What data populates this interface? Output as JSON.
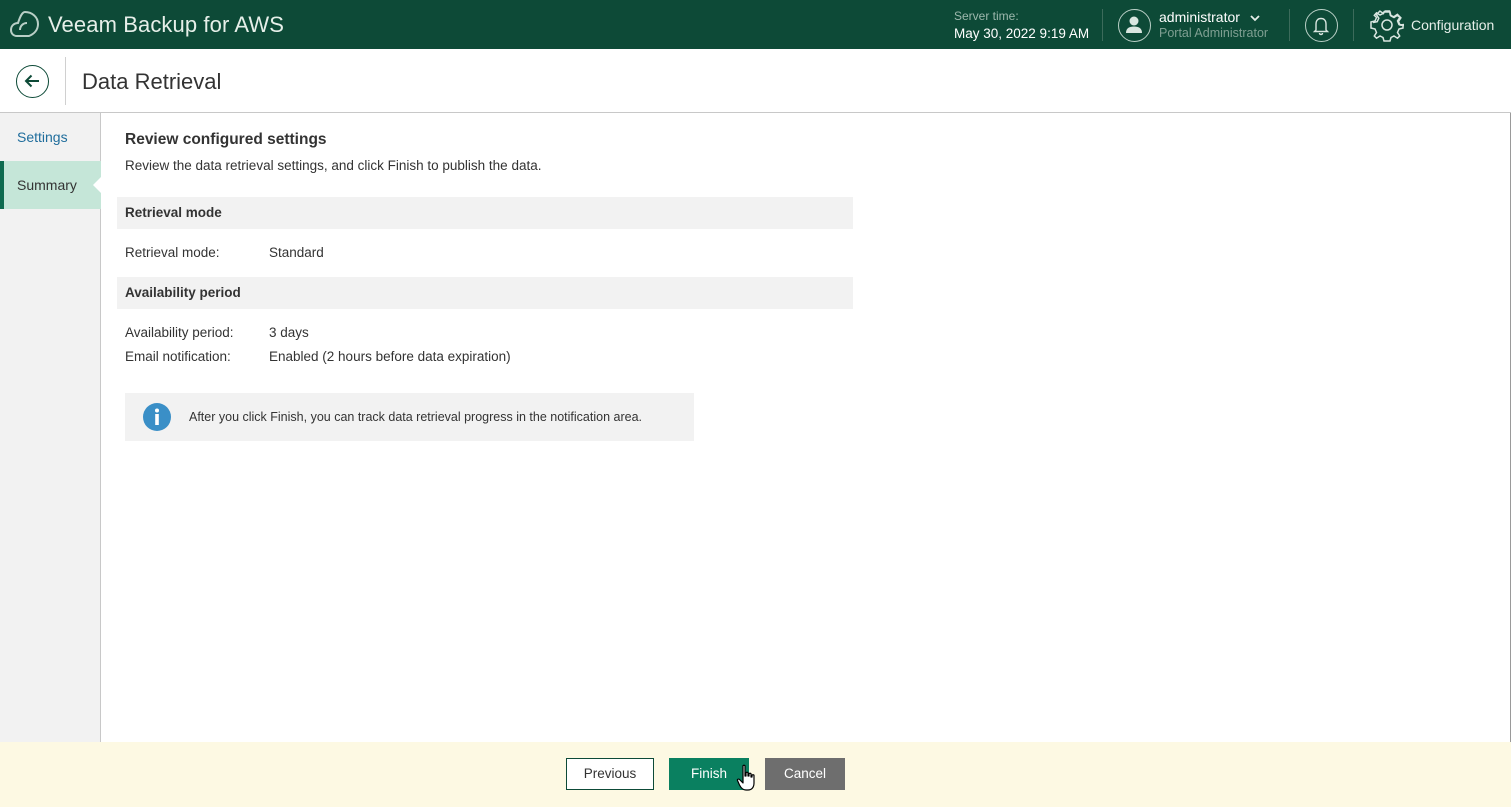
{
  "app": {
    "title": "Veeam Backup for AWS"
  },
  "topbar": {
    "server_time_label": "Server time:",
    "server_time_value": "May 30, 2022 9:19 AM",
    "user_name": "administrator",
    "user_role": "Portal Administrator",
    "config_label": "Configuration",
    "icons": [
      "veeam-logo",
      "user-avatar-icon",
      "chevron-down-icon",
      "bell-icon",
      "gear-icon"
    ]
  },
  "header": {
    "title": "Data Retrieval"
  },
  "wizard": {
    "steps": [
      {
        "label": "Settings",
        "state": "link"
      },
      {
        "label": "Summary",
        "state": "active"
      }
    ]
  },
  "summary": {
    "title": "Review configured settings",
    "description": "Review the data retrieval settings, and click Finish to publish the data.",
    "groups": [
      {
        "header": "Retrieval mode",
        "rows": [
          {
            "key": "Retrieval mode:",
            "value": "Standard"
          }
        ]
      },
      {
        "header": "Availability period",
        "rows": [
          {
            "key": "Availability period:",
            "value": "3 days"
          },
          {
            "key": "Email notification:",
            "value": "Enabled (2 hours before data expiration)"
          }
        ]
      }
    ],
    "info": "After you click Finish, you can track data retrieval progress in the notification area."
  },
  "footer": {
    "previous": "Previous",
    "finish": "Finish",
    "cancel": "Cancel"
  },
  "colors": {
    "topbar": "#0d4a37",
    "accent": "#0a8060",
    "active_step": "#c5e6d8",
    "footer_bg": "#fdf9e3",
    "info_icon": "#3a8fc7"
  }
}
